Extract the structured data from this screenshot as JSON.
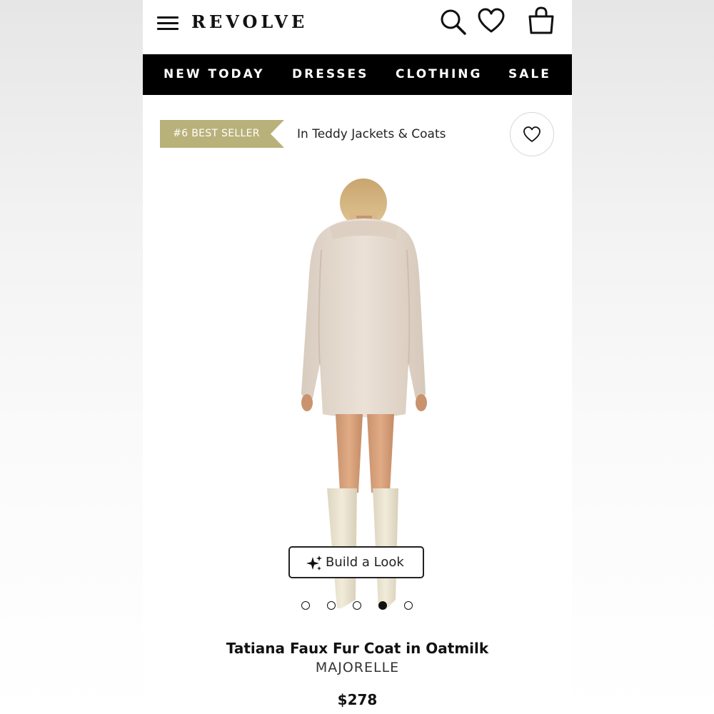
{
  "header": {
    "brand": "REVOLVE",
    "icons": [
      "menu-icon",
      "search-icon",
      "heart-icon",
      "shopping-bag-icon"
    ]
  },
  "nav": {
    "items": [
      {
        "label": "NEW TODAY"
      },
      {
        "label": "DRESSES"
      },
      {
        "label": "CLOTHING"
      },
      {
        "label": "SALE"
      }
    ]
  },
  "badge": {
    "label": "#6 BEST SELLER",
    "category": "In Teddy Jackets & Coats",
    "color": "#b9b17a"
  },
  "build_look": {
    "label": "Build a Look",
    "icon": "sparkle-icon"
  },
  "carousel": {
    "total": 5,
    "active_index": 3
  },
  "product": {
    "name": "Tatiana Faux Fur Coat in Oatmilk",
    "brand": "MAJORELLE",
    "price": "$278",
    "coat_color": "#e4d8cc",
    "boot_color": "#ece6d4"
  }
}
